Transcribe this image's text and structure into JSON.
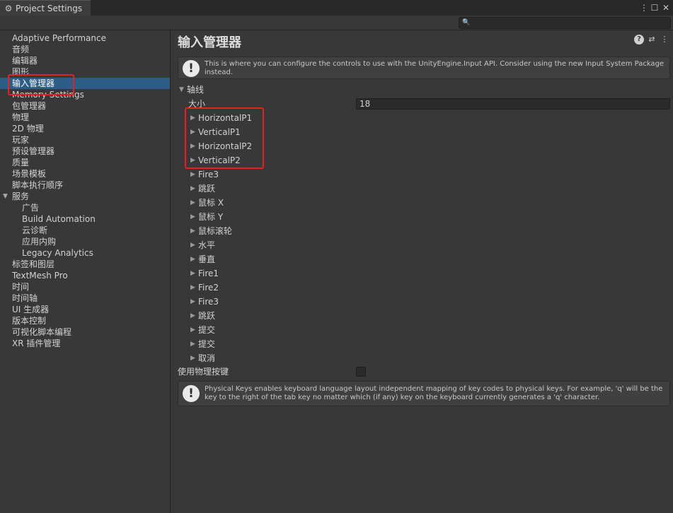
{
  "window": {
    "tab_title": "Project Settings",
    "controls": {
      "menu_icon": "kebab-menu-icon",
      "maximize_icon": "maximize-icon",
      "close_icon": "close-icon"
    }
  },
  "search": {
    "value": "",
    "icon": "search-icon"
  },
  "sidebar": {
    "items": [
      "Adaptive Performance",
      "音频",
      "编辑器",
      "图形",
      "输入管理器",
      "Memory Settings",
      "包管理器",
      "物理",
      "2D 物理",
      "玩家",
      "预设管理器",
      "质量",
      "场景模板",
      "脚本执行顺序",
      "服务",
      "广告",
      "Build Automation",
      "云诊断",
      "应用内购",
      "Legacy Analytics",
      "标签和图层",
      "TextMesh Pro",
      "时间",
      "时间轴",
      "UI 生成器",
      "版本控制",
      "可视化脚本编程",
      "XR 插件管理"
    ],
    "selected": "输入管理器"
  },
  "main": {
    "title": "输入管理器",
    "header_icons": [
      "help-icon",
      "presets-icon",
      "more-icon"
    ],
    "info_message": "This is where you can configure the controls to use with the UnityEngine.Input API. Consider using the new Input System Package instead.",
    "axes_label": "轴线",
    "size_label": "大小",
    "size_value": "18",
    "axes": [
      "HorizontalP1",
      "VerticalP1",
      "HorizontalP2",
      "VerticalP2",
      "Fire3",
      "跳跃",
      "鼠标 X",
      "鼠标 Y",
      "鼠标滚轮",
      "水平",
      "垂直",
      "Fire1",
      "Fire2",
      "Fire3",
      "跳跃",
      "提交",
      "提交",
      "取消"
    ],
    "physical_keys_label": "使用物理按键",
    "physical_keys_checked": false,
    "physical_keys_message": "Physical Keys enables keyboard language layout independent mapping of key codes to physical keys. For example, 'q' will be the key to the right of the tab key no matter which (if any) key on the keyboard currently generates a 'q' character."
  },
  "colors": {
    "highlight": "#e52121",
    "selection": "#2c5d87",
    "background": "#383838"
  }
}
